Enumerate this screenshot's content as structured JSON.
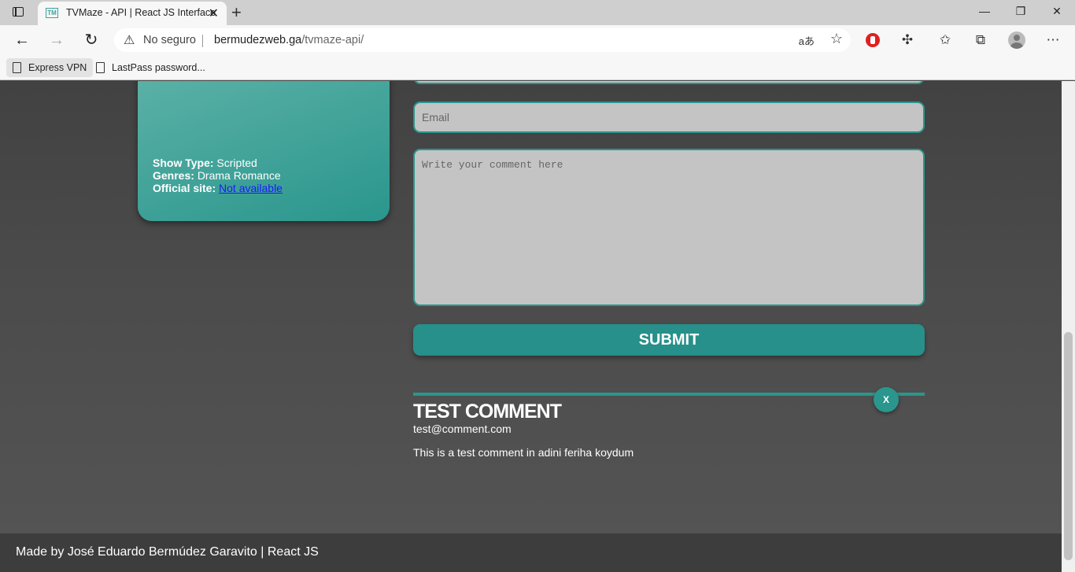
{
  "browser": {
    "tab_title": "TVMaze - API | React JS Interface",
    "tab_favicon_text": "TM",
    "address_warning": "No seguro",
    "url_host": "bermudezweb.ga",
    "url_path": "/tvmaze-api/",
    "read_aloud": "aあ",
    "bookmarks": [
      "Express VPN",
      "LastPass password..."
    ]
  },
  "show": {
    "type_label": "Show Type:",
    "type_value": "Scripted",
    "genres_label": "Genres:",
    "genres_value": "Drama Romance",
    "site_label": "Official site:",
    "site_value": "Not available"
  },
  "form": {
    "email_placeholder": "Email",
    "comment_placeholder": "Write your comment here",
    "submit_label": "SUBMIT"
  },
  "comments": [
    {
      "title": "TEST COMMENT",
      "email": "test@comment.com",
      "body": "This is a test comment in adini feriha koydum",
      "delete_label": "X"
    }
  ],
  "footer": {
    "text": "Made by José Eduardo Bermúdez Garavito | React JS"
  },
  "colors": {
    "accent": "#2a968d",
    "field_bg": "#c4c4c4",
    "page_bg": "#4a4a4a"
  }
}
